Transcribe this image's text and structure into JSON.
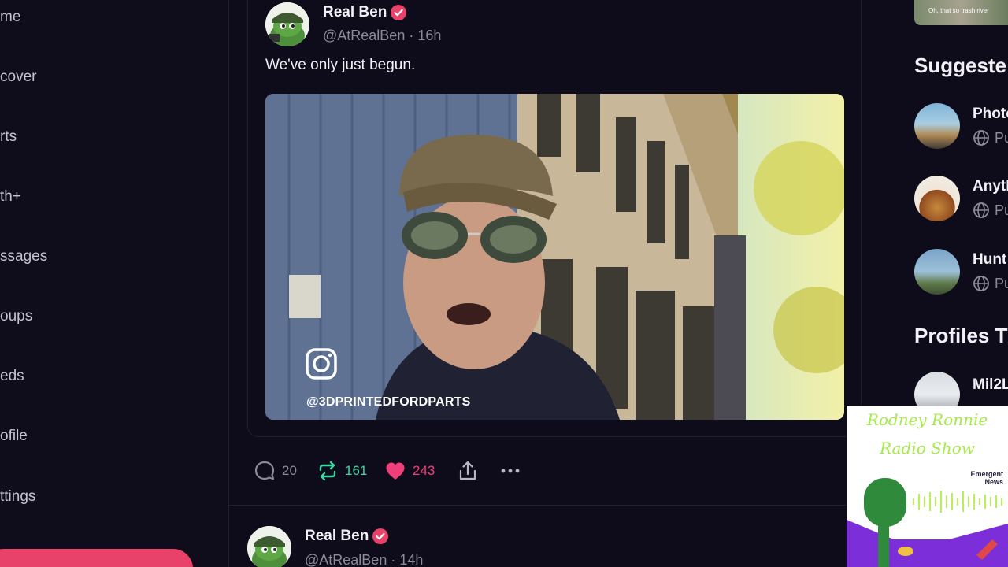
{
  "nav": {
    "items": [
      "me",
      "cover",
      "rts",
      "th+",
      "ssages",
      "oups",
      "eds",
      "ofile",
      "ttings"
    ]
  },
  "post1": {
    "name": "Real Ben",
    "handle": "@AtRealBen · 16h",
    "text": "We've only just begun.",
    "video_watermark": "@3DPRINTEDFORDPARTS",
    "actions": {
      "replies": "20",
      "reposts": "161",
      "likes": "243"
    }
  },
  "post2": {
    "name": "Real Ben",
    "handle": "@AtRealBen · 14h"
  },
  "right": {
    "thumb_caption": "Oh, that so trash river",
    "suggested_title": "Suggeste",
    "groups": [
      {
        "name": "Photo",
        "sub": "Pu"
      },
      {
        "name": "Anyth",
        "sub": "Pu"
      },
      {
        "name": "Hunt",
        "sub": "Pu"
      }
    ],
    "profiles_title": "Profiles T",
    "profiles": [
      {
        "name": "Mil2L"
      }
    ]
  },
  "overlay": {
    "line1": "Rodney Ronnie",
    "line2": "Radio Show",
    "badge": "Emergent News"
  },
  "colors": {
    "background": "#0e0b1a",
    "accent_pink": "#e8426b",
    "repost_green": "#3fd6a0",
    "like_pink": "#ee3f7a",
    "muted": "#8e8a9c"
  }
}
